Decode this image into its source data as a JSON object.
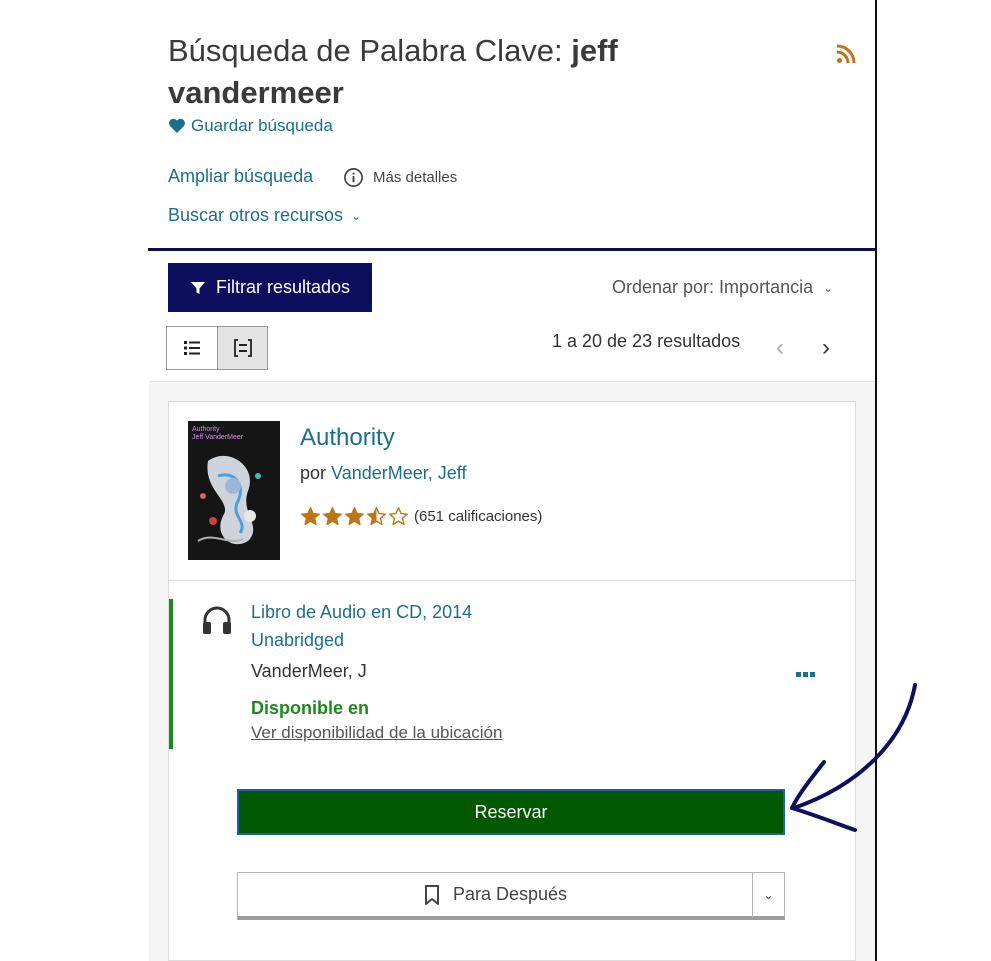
{
  "search": {
    "title_prefix": "Búsqueda de Palabra Clave: ",
    "keyword": "jeff vandermeer",
    "save_label": "Guardar búsqueda",
    "broaden_label": "Ampliar búsqueda",
    "more_details_label": "Más detalles",
    "other_resources_label": "Buscar otros recursos"
  },
  "toolbar": {
    "filter_label": "Filtrar resultados",
    "sort_label": "Ordenar por: Importancia",
    "results_count": "1 a 20 de 23 resultados"
  },
  "result": {
    "cover_text_title": "Authority",
    "cover_text_author": "Jeff VanderMeer",
    "title": "Authority",
    "by_prefix": "por ",
    "author": "VanderMeer, Jeff",
    "rating_value": 3.5,
    "rating_count": "(651 calificaciones)",
    "format": "Libro de Audio en CD, 2014",
    "edition": "Unabridged",
    "contributor": "VanderMeer, J",
    "availability": "Disponible en",
    "location_link": "Ver disponibilidad de la ubicación",
    "hold_label": "Reservar",
    "later_label": "Para Después"
  },
  "colors": {
    "link": "#1a6f8e",
    "navy": "#0e0e5e",
    "available": "#1e8a1e",
    "hold_button": "#005800",
    "star": "#c07418",
    "annotation_arrow": "#0e0e5e"
  },
  "icons": [
    "rss-icon",
    "heart-icon",
    "info-icon",
    "chevron-down-icon",
    "filter-icon",
    "list-view-icon",
    "compact-view-icon",
    "chevron-left-icon",
    "chevron-right-icon",
    "star-icon",
    "headphones-icon",
    "more-icon",
    "bookmark-icon"
  ]
}
